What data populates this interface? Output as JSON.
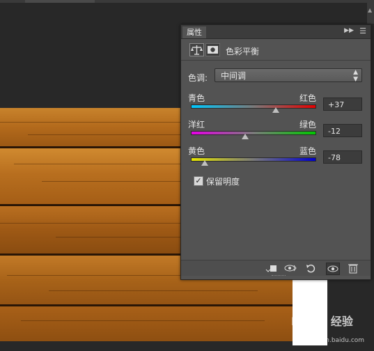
{
  "panel": {
    "tab_label": "属性",
    "tab_menu_icon": "panel-menu-icon",
    "adjustment_title": "色彩平衡",
    "tone_label": "色调:",
    "tone_value": "中间调",
    "preserve_luminosity": {
      "label": "保留明度",
      "checked": true
    }
  },
  "sliders": [
    {
      "left_label": "青色",
      "right_label": "红色",
      "value": "+37",
      "level": 37,
      "gradient": [
        "#00c8ff",
        "#e60000"
      ]
    },
    {
      "left_label": "洋红",
      "right_label": "绿色",
      "value": "-12",
      "level": -12,
      "gradient": [
        "#e600e6",
        "#00c800"
      ]
    },
    {
      "left_label": "黄色",
      "right_label": "蓝色",
      "value": "-78",
      "level": -78,
      "gradient": [
        "#e6e600",
        "#0000d2"
      ]
    }
  ],
  "footer_icons": [
    "clip-to-layer-icon",
    "view-previous-state-icon",
    "reset-icon",
    "toggle-visibility-icon",
    "delete-icon"
  ],
  "watermark": {
    "text": "Baidu 经验",
    "sub": "jingyan.baidu.com"
  }
}
